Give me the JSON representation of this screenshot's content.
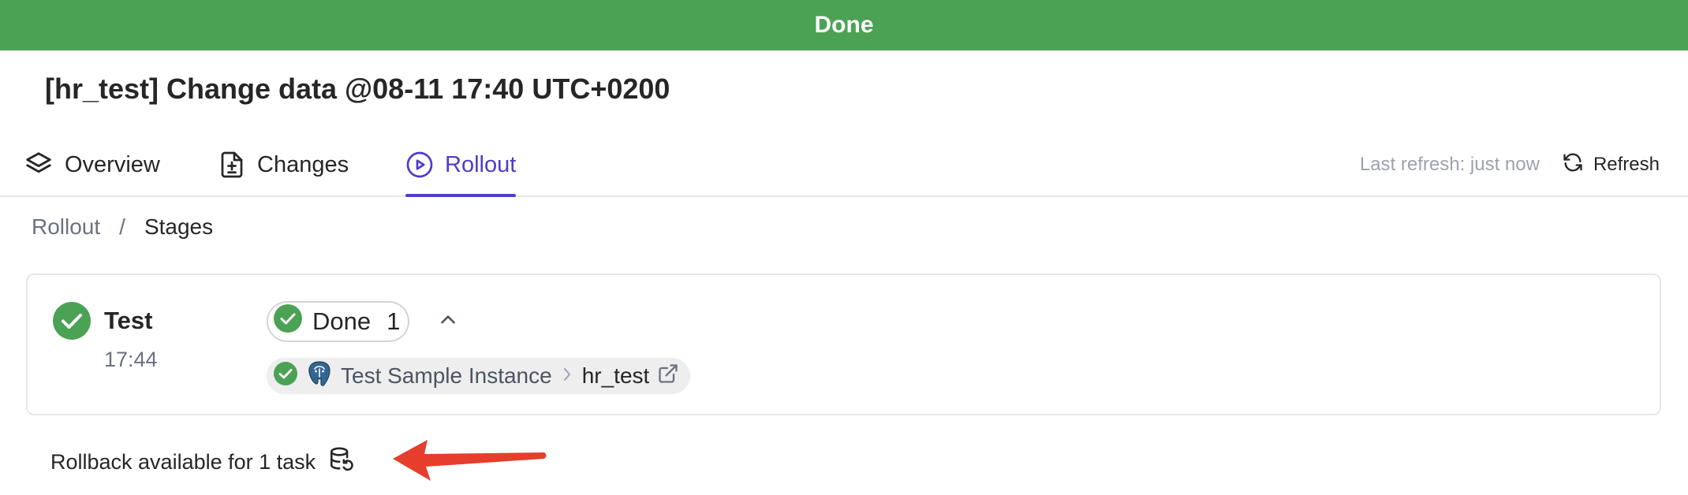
{
  "banner": {
    "text": "Done",
    "color": "#4ba255"
  },
  "header": {
    "title": "[hr_test] Change data @08-11 17:40 UTC+0200"
  },
  "tabs": [
    {
      "label": "Overview",
      "icon": "layers-icon",
      "active": false
    },
    {
      "label": "Changes",
      "icon": "file-diff-icon",
      "active": false
    },
    {
      "label": "Rollout",
      "icon": "play-circle-icon",
      "active": true
    }
  ],
  "refresh": {
    "last_refresh": "Last refresh: just now",
    "button_label": "Refresh",
    "icon": "refresh-icon"
  },
  "breadcrumb": {
    "root": "Rollout",
    "separator": "/",
    "current": "Stages"
  },
  "stage": {
    "name": "Test",
    "time": "17:44",
    "status_icon": "check-circle-icon",
    "summary": {
      "label": "Done",
      "count": "1"
    },
    "task": {
      "instance": "Test Sample Instance",
      "separator": ">",
      "database": "hr_test",
      "engine_icon": "postgresql-icon",
      "link_icon": "external-link-icon"
    }
  },
  "rollback": {
    "text": "Rollback available for 1 task",
    "icon": "database-rollback-icon"
  },
  "colors": {
    "accent": "#4f3cc9",
    "success": "#4ba255",
    "annotation_arrow": "#e53e2c"
  }
}
